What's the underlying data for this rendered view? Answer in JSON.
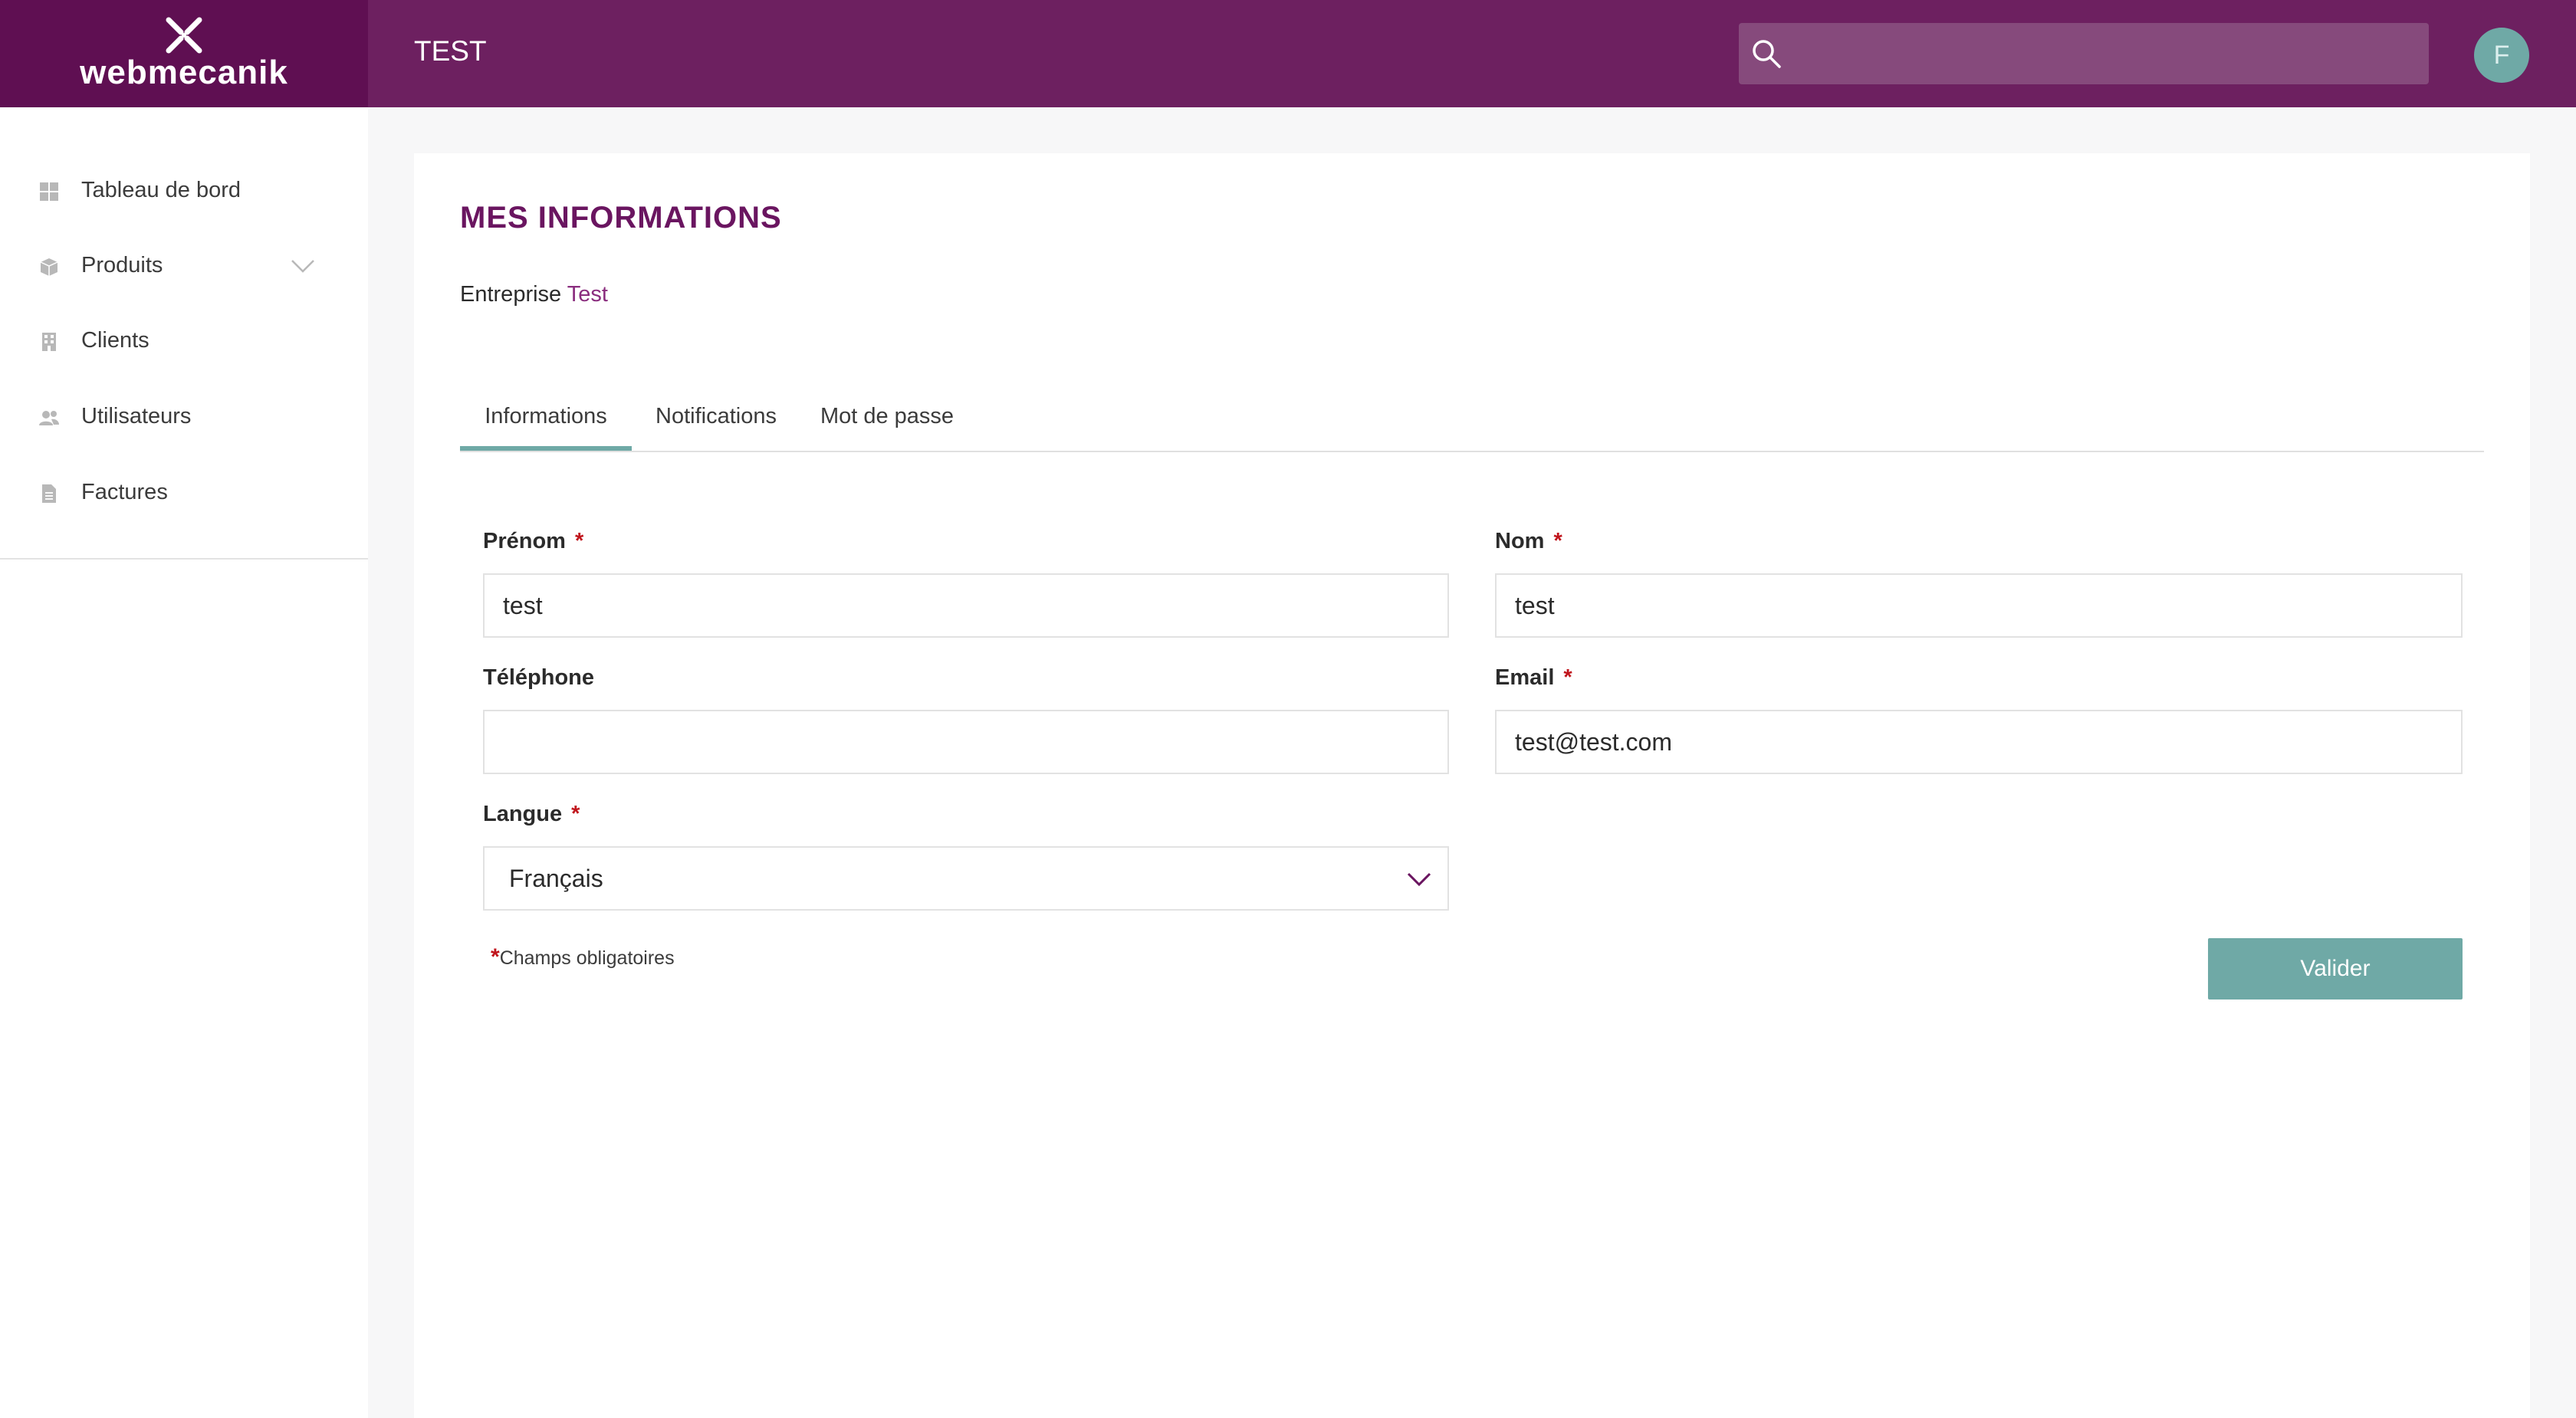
{
  "brand": {
    "logo_text": "webmecanik",
    "logo_icon": "webmecanik-mark-icon"
  },
  "header": {
    "app_title": "TEST",
    "search": {
      "placeholder": "",
      "icon": "search-icon"
    },
    "avatar_initial": "F"
  },
  "sidebar": {
    "items": [
      {
        "label": "Tableau de bord",
        "icon": "dashboard-icon"
      },
      {
        "label": "Produits",
        "icon": "box-icon",
        "expandable": true
      },
      {
        "label": "Clients",
        "icon": "building-icon"
      },
      {
        "label": "Utilisateurs",
        "icon": "users-icon"
      },
      {
        "label": "Factures",
        "icon": "document-icon"
      }
    ]
  },
  "main": {
    "title": "MES INFORMATIONS",
    "company_label": "Entreprise",
    "company_name": "Test",
    "tabs": [
      {
        "label": "Informations",
        "active": true
      },
      {
        "label": "Notifications",
        "active": false
      },
      {
        "label": "Mot de passe",
        "active": false
      }
    ],
    "form": {
      "prenom": {
        "label": "Prénom",
        "required_mark": "*",
        "value": "test"
      },
      "nom": {
        "label": "Nom",
        "required_mark": "*",
        "value": "test"
      },
      "telephone": {
        "label": "Téléphone",
        "value": ""
      },
      "email": {
        "label": "Email",
        "required_mark": "*",
        "value": "test@test.com"
      },
      "langue": {
        "label": "Langue",
        "required_mark": "*",
        "selected": "Français"
      }
    },
    "required_note": {
      "mark": "*",
      "text": "Champs obligatoires"
    },
    "submit_label": "Valider"
  },
  "colors": {
    "topbar": "#6d2060",
    "logo_block": "#5f0f52",
    "accent_teal": "#6fa9a6",
    "title_purple": "#6a1560",
    "required_red": "#c0141b"
  }
}
